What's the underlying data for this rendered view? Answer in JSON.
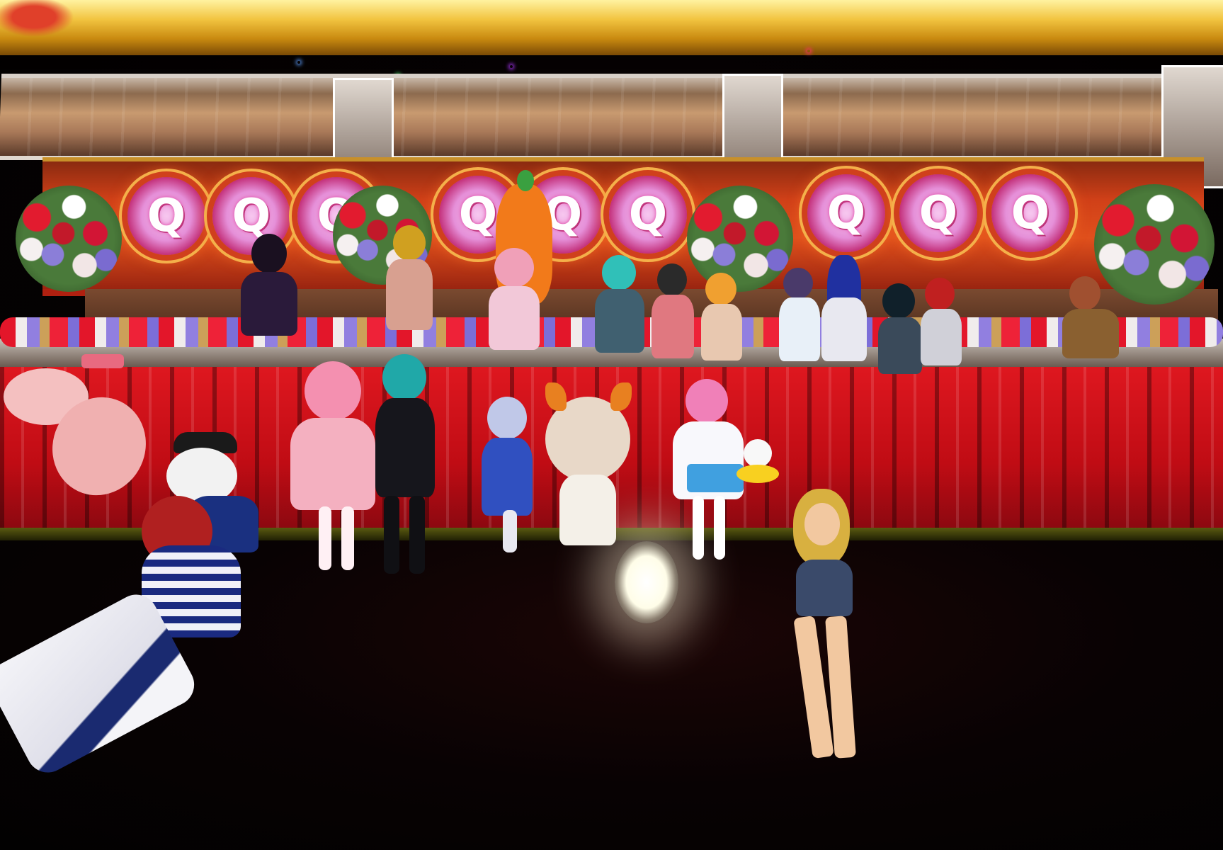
{
  "scene": {
    "description_type": "virtual-world group photo on a stage",
    "medallion_letter": "Q",
    "medallion_count": 9
  },
  "colors": {
    "stage_gold": "#d8a21a",
    "curtain_red": "#c81018",
    "medallion_pink": "#e58fd8",
    "floor_dark": "#050203",
    "spotlight": "#ffffff"
  }
}
